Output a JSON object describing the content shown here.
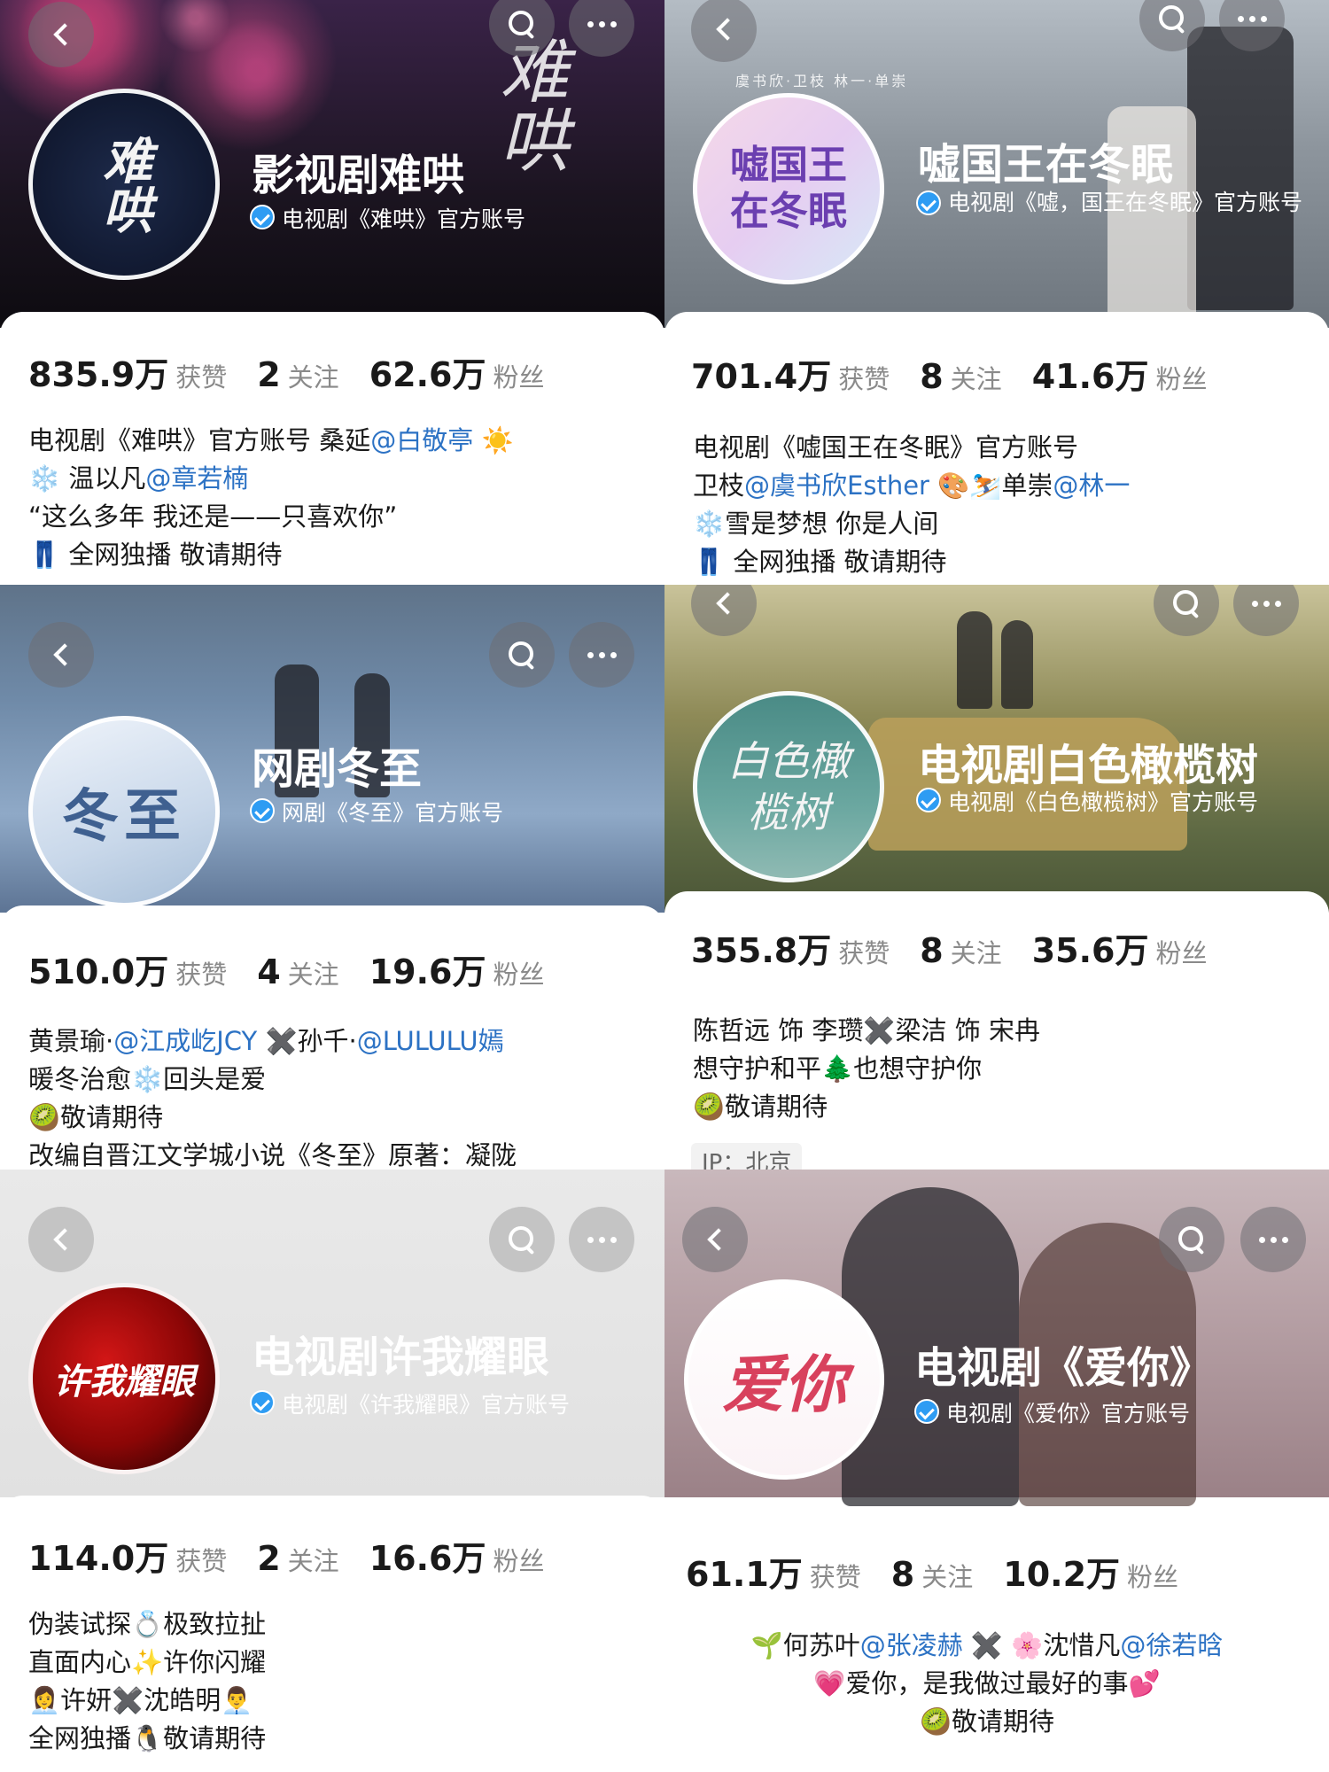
{
  "accounts": [
    {
      "name": "影视剧难哄",
      "verified": "电视剧《难哄》官方账号",
      "avatar_text": "难哄",
      "cover_art": "难哄",
      "cast_line": "",
      "stats": {
        "likes": "835.9万",
        "likes_label": "获赞",
        "following": "2",
        "following_label": "关注",
        "followers": "62.6万",
        "followers_label": "粉丝"
      },
      "bio": [
        [
          {
            "t": "电视剧《难哄》官方账号    桑延"
          },
          {
            "t": "@白敬亭",
            "m": 1
          },
          {
            "t": " ☀️"
          }
        ],
        [
          {
            "t": "❄️ 温以凡"
          },
          {
            "t": "@章若楠",
            "m": 1
          }
        ],
        [
          {
            "t": "“这么多年 我还是——只喜欢你”"
          }
        ],
        [
          {
            "t": "👖 全网独播 敬请期待"
          }
        ]
      ]
    },
    {
      "name": "嘘国王在冬眠",
      "verified": "电视剧《嘘，国王在冬眠》官方账号",
      "avatar_text": "嘘国王在冬眠",
      "cast_line": "虞书欣·卫枝      林一·单崇",
      "stats": {
        "likes": "701.4万",
        "likes_label": "获赞",
        "following": "8",
        "following_label": "关注",
        "followers": "41.6万",
        "followers_label": "粉丝"
      },
      "bio": [
        [
          {
            "t": "电视剧《嘘国王在冬眠》官方账号"
          }
        ],
        [
          {
            "t": "卫枝"
          },
          {
            "t": "@虞书欣Esther",
            "m": 1
          },
          {
            "t": " 🎨⛷️单崇"
          },
          {
            "t": "@林一",
            "m": 1
          }
        ],
        [
          {
            "t": "❄️雪是梦想 你是人间"
          }
        ],
        [
          {
            "t": "👖 全网独播 敬请期待"
          }
        ]
      ]
    },
    {
      "name": "网剧冬至",
      "verified": "网剧《冬至》官方账号",
      "avatar_text": "冬至",
      "stats": {
        "likes": "510.0万",
        "likes_label": "获赞",
        "following": "4",
        "following_label": "关注",
        "followers": "19.6万",
        "followers_label": "粉丝"
      },
      "bio": [
        [
          {
            "t": "黄景瑜·"
          },
          {
            "t": "@江成屹JCY",
            "m": 1
          },
          {
            "t": " ✖️孙千·"
          },
          {
            "t": "@LULULU嫣",
            "m": 1
          }
        ],
        [
          {
            "t": "暖冬治愈❄️回头是爱"
          }
        ],
        [
          {
            "t": "🥝敬请期待"
          }
        ],
        [
          {
            "t": "改编自晋江文学城小说《冬至》原著：凝陇"
          }
        ]
      ]
    },
    {
      "name": "电视剧白色橄榄树",
      "verified": "电视剧《白色橄榄树》官方账号",
      "avatar_text": "白色橄榄树",
      "stats": {
        "likes": "355.8万",
        "likes_label": "获赞",
        "following": "8",
        "following_label": "关注",
        "followers": "35.6万",
        "followers_label": "粉丝"
      },
      "bio": [
        [
          {
            "t": "陈哲远 饰 李瓒✖️梁洁 饰 宋冉"
          }
        ],
        [
          {
            "t": "想守护和平🌲也想守护你"
          }
        ],
        [
          {
            "t": "🥝敬请期待"
          }
        ]
      ],
      "ip": "IP：北京"
    },
    {
      "name": "电视剧许我耀眼",
      "verified": "电视剧《许我耀眼》官方账号",
      "avatar_text": "许我耀眼",
      "stats": {
        "likes": "114.0万",
        "likes_label": "获赞",
        "following": "2",
        "following_label": "关注",
        "followers": "16.6万",
        "followers_label": "粉丝"
      },
      "bio": [
        [
          {
            "t": "伪装试探💍极致拉扯"
          }
        ],
        [
          {
            "t": "直面内心✨许你闪耀"
          }
        ],
        [
          {
            "t": "👩‍💼许妍✖️沈皓明👨‍💼"
          }
        ],
        [
          {
            "t": "全网独播🐧敬请期待"
          }
        ]
      ]
    },
    {
      "name": "电视剧《爱你》",
      "verified": "电视剧《爱你》官方账号",
      "avatar_text": "爱你",
      "stats": {
        "likes": "61.1万",
        "likes_label": "获赞",
        "following": "8",
        "following_label": "关注",
        "followers": "10.2万",
        "followers_label": "粉丝"
      },
      "bio": [
        [
          {
            "t": "🌱何苏叶"
          },
          {
            "t": "@张凌赫",
            "m": 1
          },
          {
            "t": " ✖️ 🌸沈惜凡"
          },
          {
            "t": "@徐若晗",
            "m": 1
          }
        ],
        [
          {
            "t": "💗爱你，是我做过最好的事💕"
          }
        ],
        [
          {
            "t": "🥝敬请期待"
          }
        ]
      ]
    }
  ],
  "icons": {
    "back": "chevron-left-icon",
    "search": "search-icon",
    "more": "more-dots-icon",
    "verified": "verified-badge-icon"
  }
}
